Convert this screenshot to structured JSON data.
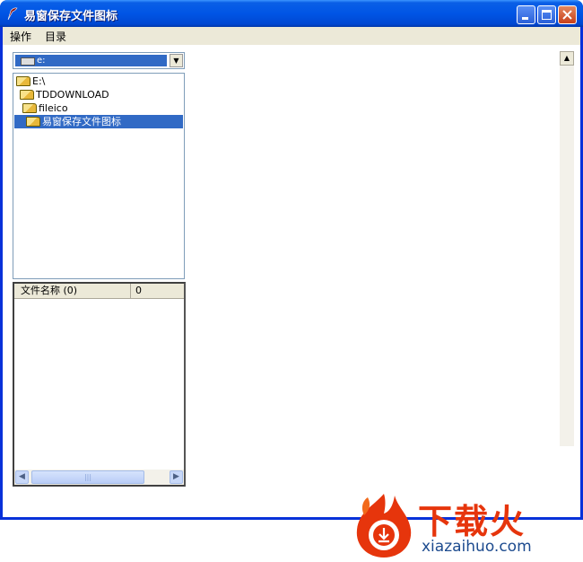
{
  "window": {
    "title": "易窗保存文件图标"
  },
  "menu": {
    "items": [
      "操作",
      "目录"
    ]
  },
  "drive_combo": {
    "selected": "e:"
  },
  "dir_tree": {
    "items": [
      {
        "label": "E:\\",
        "selected": false
      },
      {
        "label": "TDDOWNLOAD",
        "selected": false
      },
      {
        "label": "fileico",
        "selected": false
      },
      {
        "label": "易窗保存文件图标",
        "selected": true
      }
    ]
  },
  "file_list": {
    "columns": [
      "文件名称 (0)",
      "0"
    ]
  },
  "scrollbar": {
    "thumb_grip": "|||"
  },
  "watermark": {
    "title": "下载火",
    "url": "xiazaihuo.com"
  },
  "colors": {
    "titlebar": "#0055E5",
    "selection": "#316AC5",
    "watermark_red": "#E6350C",
    "watermark_blue": "#1D4B8F"
  },
  "icons": {
    "app": "app-feather-icon",
    "minimize": "minimize-icon",
    "maximize": "maximize-icon",
    "close": "close-icon"
  }
}
